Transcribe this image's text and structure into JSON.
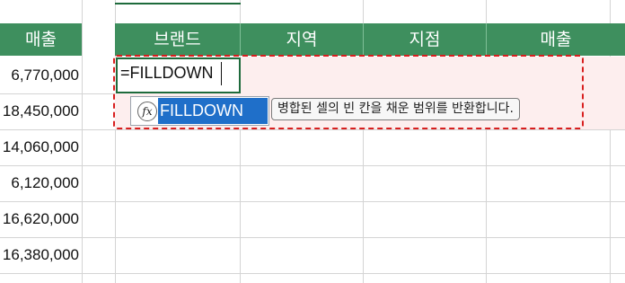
{
  "headers": {
    "col_sales_left": "매출",
    "brand": "브랜드",
    "region": "지역",
    "branch": "지점",
    "sales": "매출"
  },
  "sales_values": [
    "6,770,000",
    "18,450,000",
    "14,060,000",
    "6,120,000",
    "16,620,000",
    "16,380,000"
  ],
  "formula_input": "=FILLDOWN",
  "autocomplete": {
    "icon": "function-icon",
    "icon_glyph": "fx",
    "item": "FILLDOWN",
    "tooltip": "병합된 셀의 빈 칸을 채운 범위를 반환합니다."
  },
  "colors": {
    "header_green": "#3e8f5e",
    "selection_green": "#1e6b3c",
    "autocomplete_blue": "#1f6fc9",
    "dashed_red": "#d81e1e"
  }
}
